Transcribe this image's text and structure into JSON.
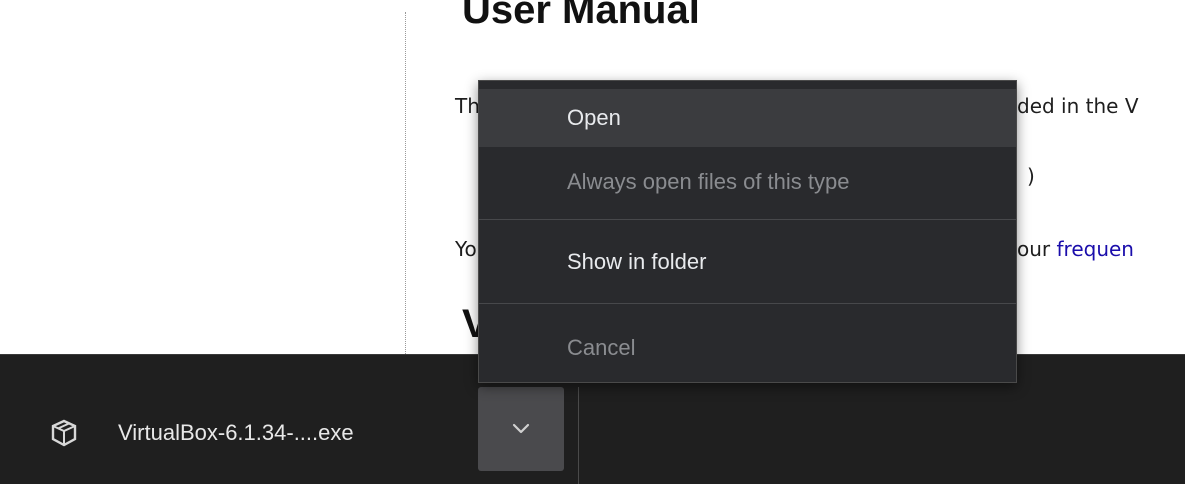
{
  "page": {
    "heading_top": "User Manual",
    "heading_bottom": "V",
    "para1": "Th",
    "para1_right": "ded in the V",
    "para2_right": ")",
    "para3_left": "Yo",
    "para3_mid": "our ",
    "para3_link": "frequen"
  },
  "context_menu": {
    "open": "Open",
    "always_open": "Always open files of this type",
    "show_in_folder": "Show in folder",
    "cancel": "Cancel"
  },
  "download_shelf": {
    "file_name": "VirtualBox-6.1.34-....exe",
    "file_icon": "virtualbox-icon",
    "menu_icon": "chevron-down-icon"
  },
  "colors": {
    "shelf_bg": "#1f1f1f",
    "menu_bg": "#292a2d",
    "menu_highlight": "#3b3c3f",
    "link": "#1a0dab"
  }
}
